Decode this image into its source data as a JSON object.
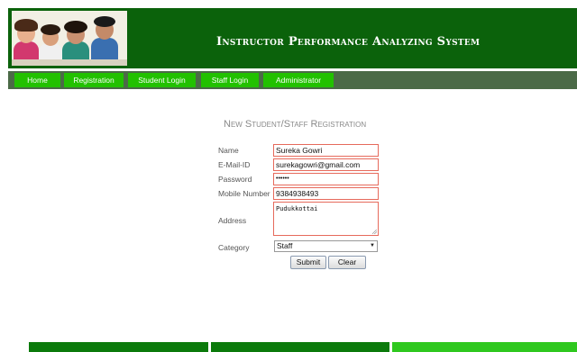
{
  "header": {
    "title": "Instructor Performance Analyzing System"
  },
  "nav": {
    "items": [
      "Home",
      "Registration",
      "Student Login",
      "Staff Login",
      "Administrator"
    ]
  },
  "form": {
    "title": "New Student/Staff Registration",
    "labels": {
      "name": "Name",
      "email": "E-Mail-ID",
      "password": "Password",
      "mobile": "Mobile Number",
      "address": "Address",
      "category": "Category"
    },
    "values": {
      "name": "Sureka Gowri",
      "email": "surekagowri@gmail.com",
      "password": "••••••",
      "mobile": "9384938493",
      "address": "Pudukkottai",
      "category": "Staff"
    },
    "buttons": {
      "submit": "Submit",
      "clear": "Clear"
    }
  },
  "colors": {
    "header_bg": "#0b620b",
    "nav_bg": "#4b6a47",
    "nav_item": "#22c100",
    "field_border": "#e66a5c"
  }
}
